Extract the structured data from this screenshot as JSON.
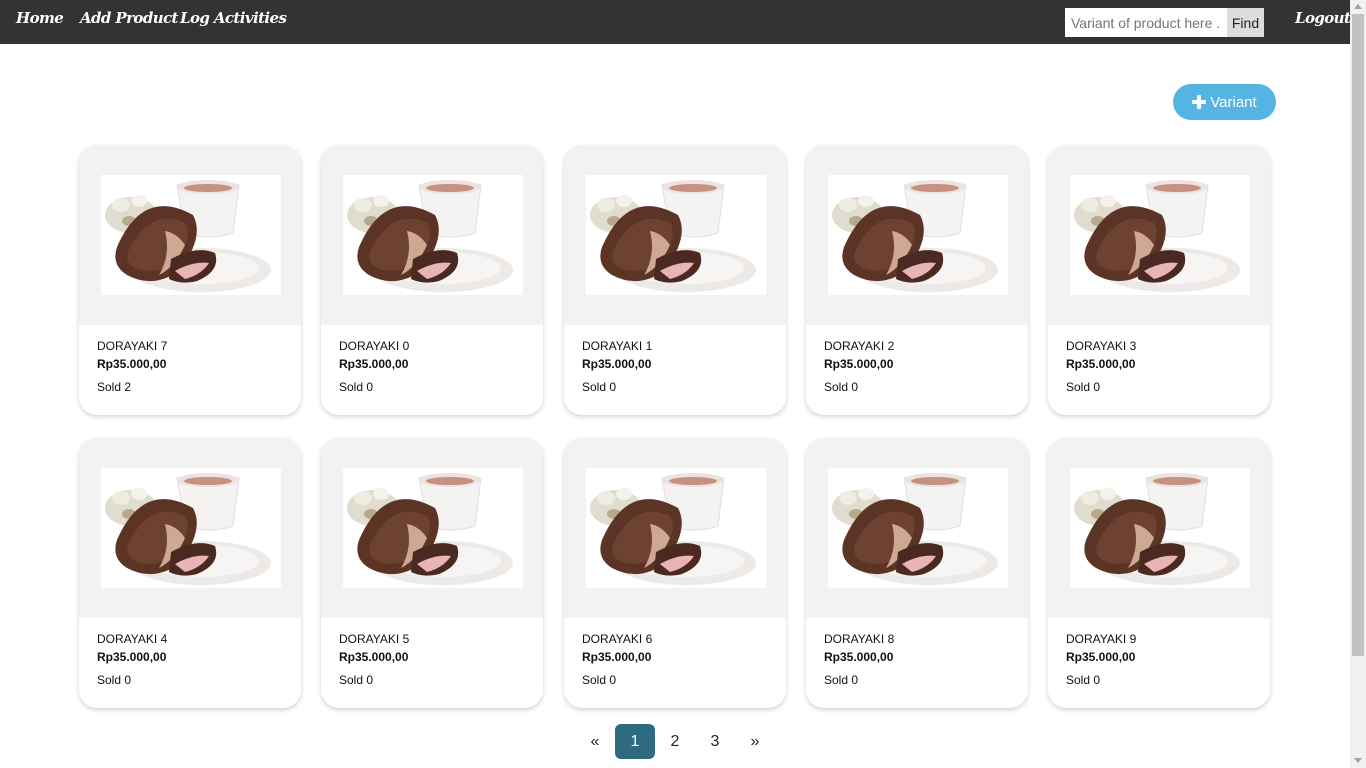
{
  "navbar": {
    "home": "Home",
    "add_product": "Add Product",
    "log_activities": "Log Activities",
    "logout": "Logout",
    "search_placeholder": "Variant of product here ...",
    "find_label": "Find"
  },
  "actions": {
    "add_variant_label": "Variant",
    "add_variant_icon": "plus-icon"
  },
  "products": [
    {
      "name": "DORAYAKI 7",
      "price": "Rp35.000,00",
      "sold": "Sold 2"
    },
    {
      "name": "DORAYAKI 0",
      "price": "Rp35.000,00",
      "sold": "Sold 0"
    },
    {
      "name": "DORAYAKI 1",
      "price": "Rp35.000,00",
      "sold": "Sold 0"
    },
    {
      "name": "DORAYAKI 2",
      "price": "Rp35.000,00",
      "sold": "Sold 0"
    },
    {
      "name": "DORAYAKI 3",
      "price": "Rp35.000,00",
      "sold": "Sold 0"
    },
    {
      "name": "DORAYAKI 4",
      "price": "Rp35.000,00",
      "sold": "Sold 0"
    },
    {
      "name": "DORAYAKI 5",
      "price": "Rp35.000,00",
      "sold": "Sold 0"
    },
    {
      "name": "DORAYAKI 6",
      "price": "Rp35.000,00",
      "sold": "Sold 0"
    },
    {
      "name": "DORAYAKI 8",
      "price": "Rp35.000,00",
      "sold": "Sold 0"
    },
    {
      "name": "DORAYAKI 9",
      "price": "Rp35.000,00",
      "sold": "Sold 0"
    }
  ],
  "pagination": {
    "prev": "«",
    "pages": [
      "1",
      "2",
      "3"
    ],
    "current": "1",
    "next": "»"
  },
  "colors": {
    "navbar": "#333333",
    "accent": "#56b4e5",
    "active_page": "#2e6a80"
  }
}
